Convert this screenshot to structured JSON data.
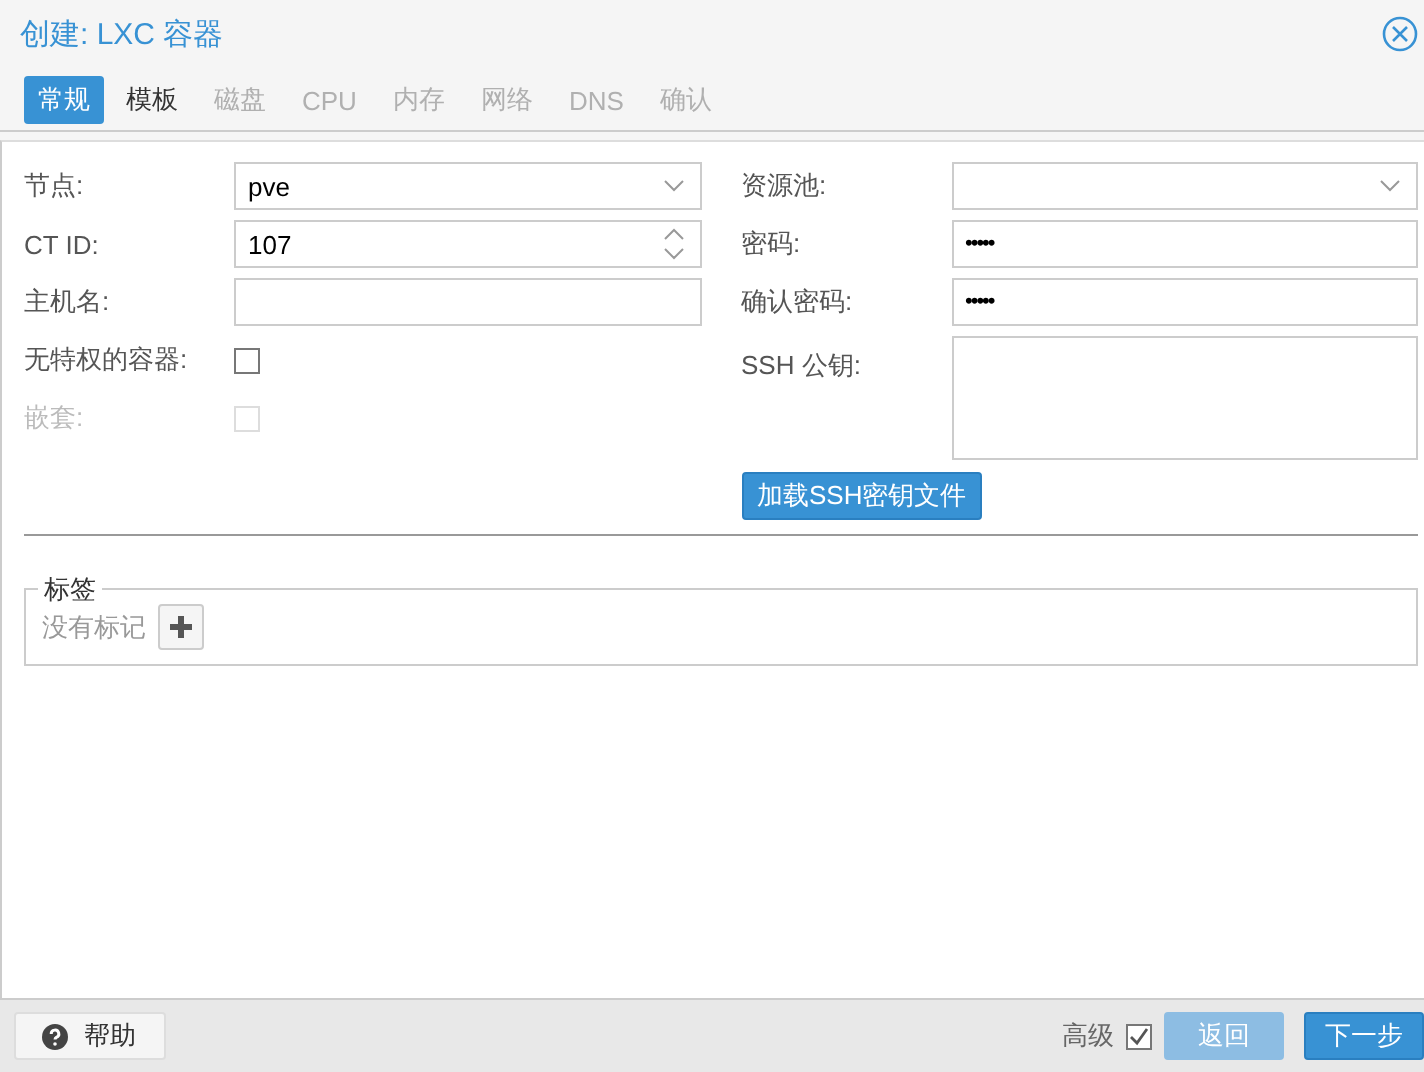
{
  "window": {
    "title": "创建: LXC 容器"
  },
  "tabs": [
    {
      "label": "常规",
      "selected": true,
      "disabled": false
    },
    {
      "label": "模板",
      "selected": false,
      "disabled": false
    },
    {
      "label": "磁盘",
      "selected": false,
      "disabled": true
    },
    {
      "label": "CPU",
      "selected": false,
      "disabled": true
    },
    {
      "label": "内存",
      "selected": false,
      "disabled": true
    },
    {
      "label": "网络",
      "selected": false,
      "disabled": true
    },
    {
      "label": "DNS",
      "selected": false,
      "disabled": true
    },
    {
      "label": "确认",
      "selected": false,
      "disabled": true
    }
  ],
  "left_fields": [
    {
      "kind": "combo",
      "label": "节点:",
      "value": "pve",
      "disabled": false
    },
    {
      "kind": "spinner",
      "label": "CT ID:",
      "value": "107",
      "disabled": false
    },
    {
      "kind": "text",
      "label": "主机名:",
      "disabled": false
    },
    {
      "kind": "checkbox",
      "label": "无特权的容器:",
      "checked": false,
      "disabled": false
    },
    {
      "kind": "checkbox",
      "label": "嵌套:",
      "checked": false,
      "disabled": true
    }
  ],
  "right_fields": [
    {
      "kind": "combo",
      "label": "资源池:"
    },
    {
      "kind": "password",
      "label": "密码:",
      "value": "•••••"
    },
    {
      "kind": "password",
      "label": "确认密码:",
      "value": "•••••"
    },
    {
      "kind": "textarea",
      "label": "SSH 公钥:"
    }
  ],
  "load_key_button": "加载SSH密钥文件",
  "tags": {
    "legend": "标签",
    "empty_text": "没有标记"
  },
  "footer": {
    "help_button": "帮助",
    "advanced_label": "高级",
    "advanced_checked": true,
    "back_button": "返回",
    "back_disabled": true,
    "next_button": "下一步"
  }
}
